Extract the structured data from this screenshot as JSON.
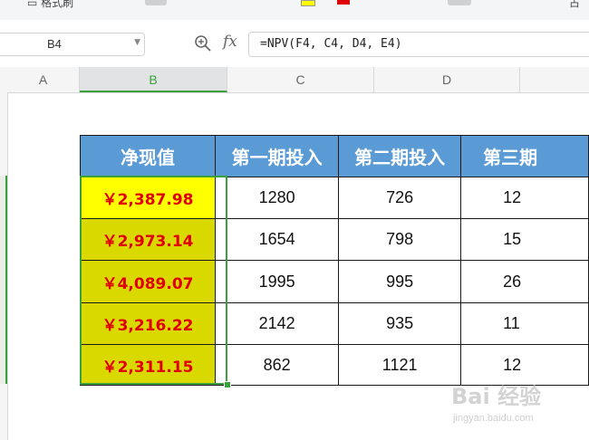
{
  "formula_bar": {
    "name_box": "B4",
    "formula": "=NPV(F4, C4, D4, E4)"
  },
  "toolbar": {
    "partial_label": "格式刷",
    "right_label": "占"
  },
  "columns": [
    {
      "letter": "A",
      "active": false
    },
    {
      "letter": "B",
      "active": true
    },
    {
      "letter": "C",
      "active": false
    },
    {
      "letter": "D",
      "active": false
    }
  ],
  "table": {
    "headers": [
      "净现值",
      "第一期投入",
      "第二期投入",
      "第三期"
    ],
    "rows": [
      {
        "npv": "￥2,387.98",
        "c": "1280",
        "d": "726",
        "e": "12"
      },
      {
        "npv": "￥2,973.14",
        "c": "1654",
        "d": "798",
        "e": "15"
      },
      {
        "npv": "￥4,089.07",
        "c": "1995",
        "d": "995",
        "e": "26"
      },
      {
        "npv": "￥3,216.22",
        "c": "2142",
        "d": "935",
        "e": "11"
      },
      {
        "npv": "￥2,311.15",
        "c": "862",
        "d": "1121",
        "e": "12"
      }
    ]
  },
  "colors": {
    "header_fill": "#5b9bd5",
    "npv_text": "#e00000",
    "npv_fill": "#d9d900",
    "selected_fill": "#ffff00",
    "selection_border": "#3aa03a"
  },
  "watermark": {
    "brand": "Bai 经验",
    "url": "jingyan.baidu.com"
  }
}
